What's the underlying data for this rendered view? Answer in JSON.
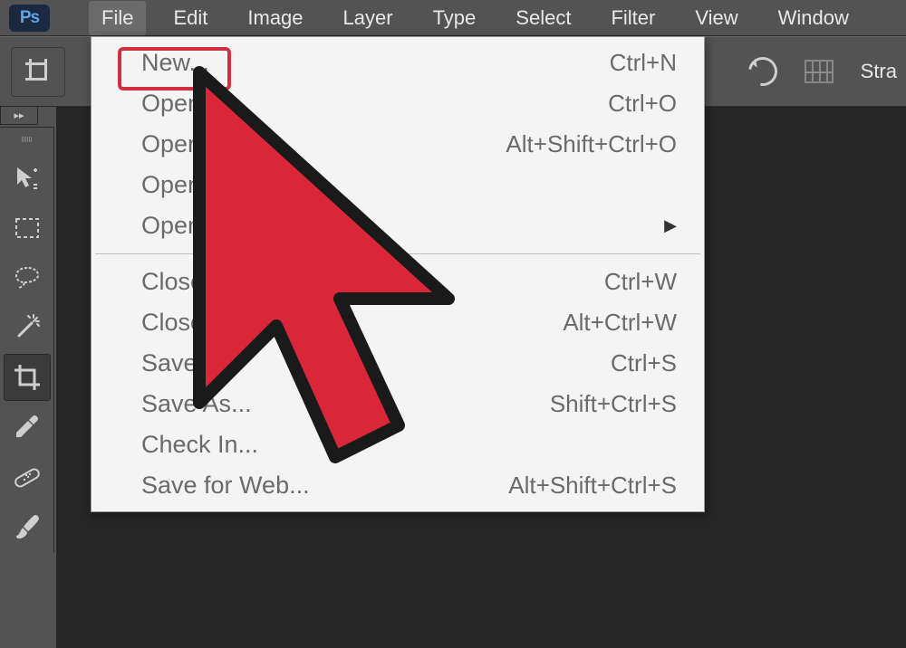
{
  "menubar": {
    "items": [
      "File",
      "Edit",
      "Image",
      "Layer",
      "Type",
      "Select",
      "Filter",
      "View",
      "Window"
    ],
    "active_index": 0
  },
  "options_bar": {
    "right_label": "Stra"
  },
  "tools": [
    {
      "name": "move-tool",
      "active": false
    },
    {
      "name": "marquee-tool",
      "active": false
    },
    {
      "name": "lasso-tool",
      "active": false
    },
    {
      "name": "quick-selection-tool",
      "active": false
    },
    {
      "name": "crop-tool",
      "active": true
    },
    {
      "name": "eyedropper-tool",
      "active": false
    },
    {
      "name": "healing-brush-tool",
      "active": false
    },
    {
      "name": "brush-tool",
      "active": false
    }
  ],
  "file_menu": {
    "groups": [
      [
        {
          "label": "New...",
          "shortcut": "Ctrl+N",
          "highlighted": true
        },
        {
          "label": "Open",
          "shortcut": "Ctrl+O"
        },
        {
          "label": "Open",
          "shortcut": "Alt+Shift+Ctrl+O"
        },
        {
          "label": "Open a",
          "shortcut": ""
        },
        {
          "label": "Open R",
          "shortcut": "",
          "submenu": true
        }
      ],
      [
        {
          "label": "Close",
          "shortcut": "Ctrl+W"
        },
        {
          "label": "Close All",
          "shortcut": "Alt+Ctrl+W"
        },
        {
          "label": "Save",
          "shortcut": "Ctrl+S"
        },
        {
          "label": "Save As...",
          "shortcut": "Shift+Ctrl+S"
        },
        {
          "label": "Check In...",
          "shortcut": ""
        },
        {
          "label": "Save for Web...",
          "shortcut": "Alt+Shift+Ctrl+S"
        }
      ]
    ]
  }
}
